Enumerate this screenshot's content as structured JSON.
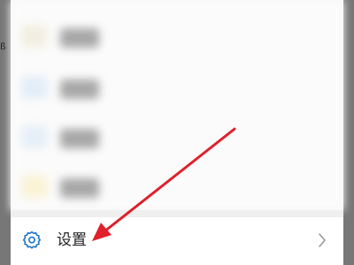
{
  "background_left_peek_text": "ß",
  "blurred_rows": [
    {
      "icon_color": "#f2efe2"
    },
    {
      "icon_color": "#e3eef8"
    },
    {
      "icon_color": "#e6eff7"
    },
    {
      "icon_color": "#faf3d6"
    }
  ],
  "settings_item": {
    "label": "设置",
    "icon": "gear-icon",
    "chevron": "chevron-right-icon",
    "icon_color": "#1e73c8"
  },
  "annotation": {
    "arrow_color": "#e0202a"
  }
}
